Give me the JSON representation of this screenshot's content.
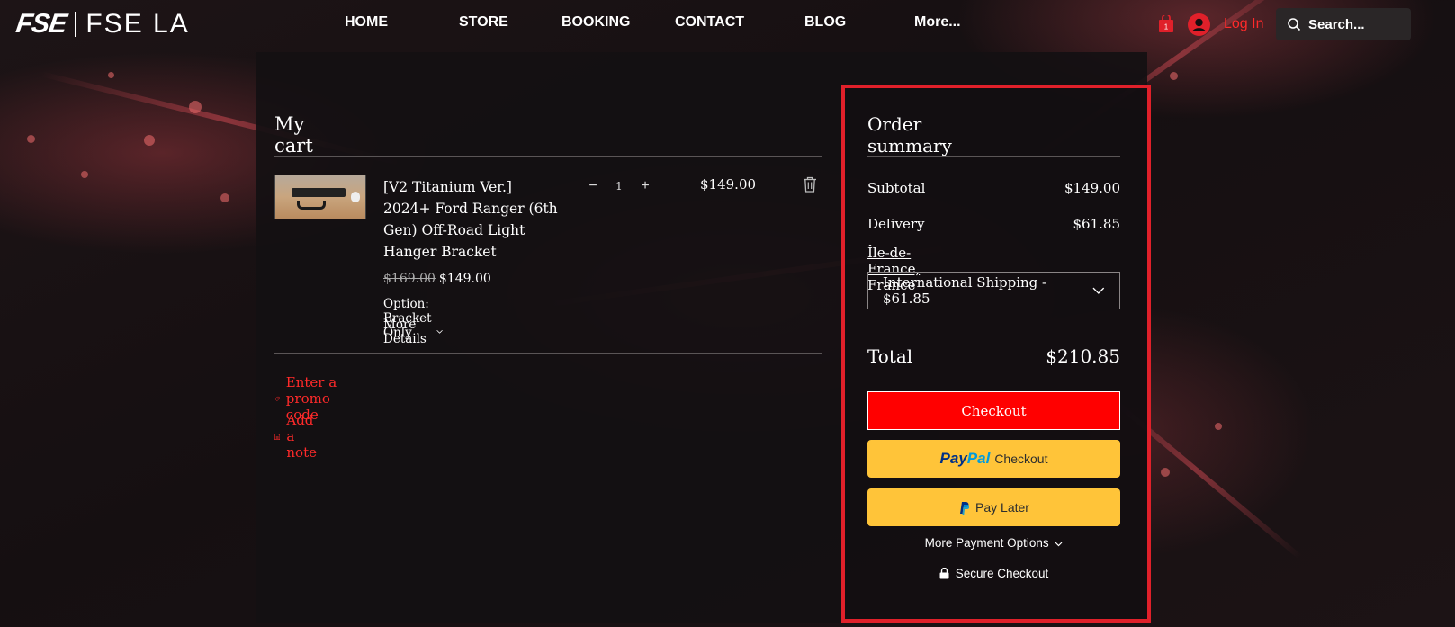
{
  "brand": {
    "mark": "FSE",
    "name": "FSE LA"
  },
  "nav": {
    "items": [
      {
        "label": "HOME"
      },
      {
        "label": "STORE"
      },
      {
        "label": "BOOKING"
      },
      {
        "label": "CONTACT"
      },
      {
        "label": "BLOG"
      },
      {
        "label": "More..."
      }
    ]
  },
  "header": {
    "cart_count": "1",
    "login_label": "Log In",
    "search_placeholder": "Search..."
  },
  "cart": {
    "title": "My cart",
    "item": {
      "name": "[V2 Titanium Ver.] 2024+ Ford Ranger (6th Gen) Off-Road Light Hanger Bracket",
      "original_price": "$169.00",
      "price": "$149.00",
      "option": "Option: Bracket Only",
      "more_details_label": "More Details",
      "quantity": "1",
      "line_total": "$149.00"
    },
    "promo_label": "Enter a promo code",
    "note_label": "Add a note"
  },
  "summary": {
    "title": "Order summary",
    "subtotal_label": "Subtotal",
    "subtotal_value": "$149.00",
    "delivery_label": "Delivery",
    "delivery_value": "$61.85",
    "region": "Île-de-France, France",
    "shipping_option": "International Shipping - $61.85",
    "total_label": "Total",
    "total_value": "$210.85",
    "checkout_label": "Checkout",
    "paypal_pay": "Pay",
    "paypal_pal": "Pal",
    "paypal_checkout_label": "Checkout",
    "pay_later_label": "Pay Later",
    "more_payment_label": "More Payment Options",
    "secure_label": "Secure Checkout"
  },
  "colors": {
    "accent": "#ff2a2a",
    "checkout_bg": "#ff0000",
    "paypal_bg": "#ffc439",
    "highlight_border": "#e0202a"
  }
}
